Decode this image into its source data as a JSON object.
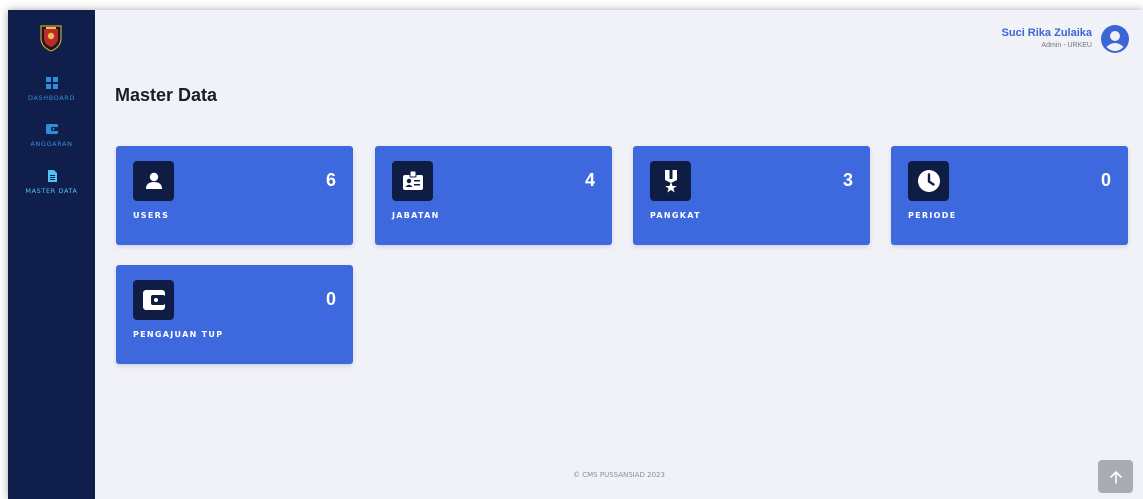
{
  "sidebar": {
    "items": [
      {
        "label": "DASHBOARD",
        "icon": "dashboard-grid-icon",
        "active": false
      },
      {
        "label": "ANGGARAN",
        "icon": "wallet-icon",
        "active": false
      },
      {
        "label": "MASTER DATA",
        "icon": "document-icon",
        "active": true
      }
    ]
  },
  "user": {
    "name": "Suci Rika Zulaika",
    "role": "Admin - URKEU",
    "avatar_icon": "user-circle-icon"
  },
  "page": {
    "title": "Master Data"
  },
  "cards": [
    {
      "label": "USERS",
      "value": "6",
      "icon": "user-icon"
    },
    {
      "label": "JABATAN",
      "value": "4",
      "icon": "id-badge-icon"
    },
    {
      "label": "PANGKAT",
      "value": "3",
      "icon": "medal-icon"
    },
    {
      "label": "PERIODE",
      "value": "0",
      "icon": "clock-icon"
    },
    {
      "label": "PENGAJUAN TUP",
      "value": "0",
      "icon": "wallet-icon"
    }
  ],
  "footer": {
    "text": "© CMS PUSSANSIAD 2023"
  },
  "colors": {
    "sidebar_bg": "#0f1e4b",
    "card_bg": "#3e69de",
    "card_icon_bg": "#0f1d45",
    "accent": "#3c66d6",
    "page_bg": "#f1f2f7"
  }
}
